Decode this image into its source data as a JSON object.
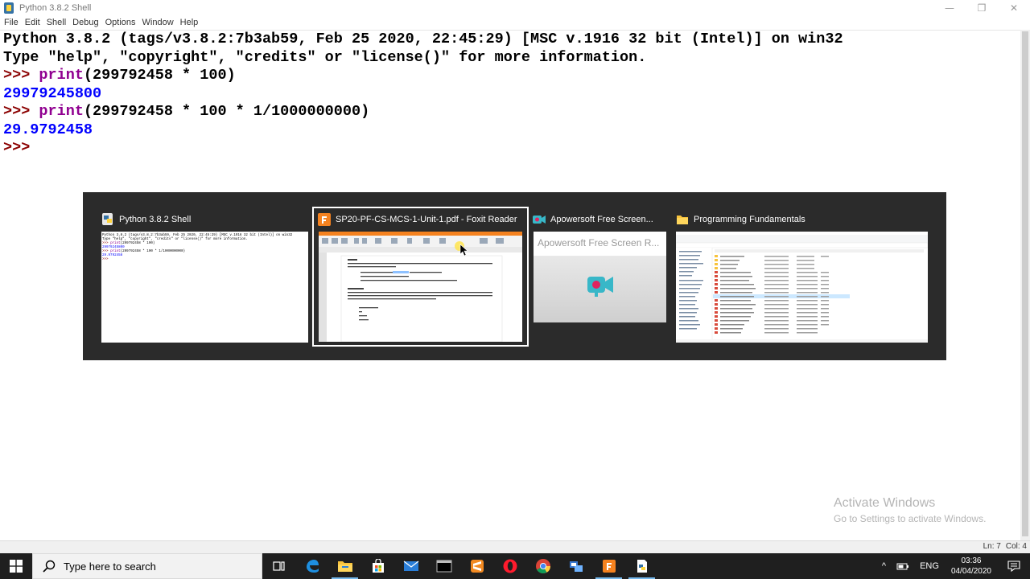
{
  "window": {
    "title": "Python 3.8.2 Shell",
    "minimize_glyph": "—",
    "maximize_glyph": "❐",
    "close_glyph": "✕"
  },
  "menu": [
    "File",
    "Edit",
    "Shell",
    "Debug",
    "Options",
    "Window",
    "Help"
  ],
  "shell": {
    "banner1": "Python 3.8.2 (tags/v3.8.2:7b3ab59, Feb 25 2020, 22:45:29) [MSC v.1916 32 bit (Intel)] on win32",
    "banner2": "Type \"help\", \"copyright\", \"credits\" or \"license()\" for more information.",
    "prompt": ">>>",
    "cmd1_func": "print",
    "cmd1_args": "(299792458 * 100)",
    "out1": "29979245800",
    "cmd2_func": "print",
    "cmd2_args": "(299792458 * 100 * 1/1000000000)",
    "out2": "29.9792458"
  },
  "status": {
    "line": "Ln: 7",
    "col": "Col: 4"
  },
  "watermark": {
    "title": "Activate Windows",
    "subtitle": "Go to Settings to activate Windows."
  },
  "switcher": {
    "windows": [
      {
        "label": "Python 3.8.2 Shell",
        "icon": "python-idle-icon"
      },
      {
        "label": "SP20-PF-CS-MCS-1-Unit-1.pdf - Foxit Reader",
        "icon": "foxit-reader-icon",
        "selected": true
      },
      {
        "label": "Apowersoft Free Screen...",
        "icon": "apowersoft-icon"
      },
      {
        "label": "Programming Fundamentals",
        "icon": "folder-icon"
      }
    ],
    "apowersoft_preview_text": "Apowersoft Free Screen R..."
  },
  "taskbar": {
    "search_placeholder": "Type here to search",
    "lang": "ENG",
    "time": "03:36",
    "date": "04/04/2020",
    "tray_up_glyph": "^",
    "colors": {
      "taskbar": "#1f1f1f",
      "accent": "#76b9ed"
    }
  }
}
